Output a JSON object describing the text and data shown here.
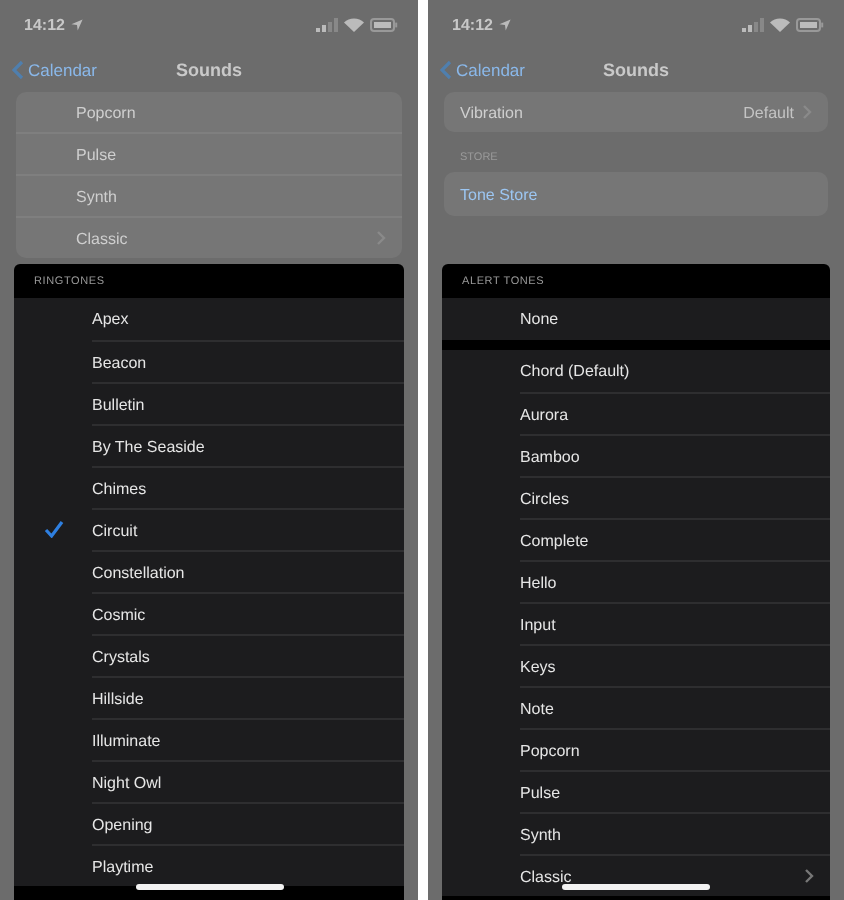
{
  "screens": [
    {
      "status": {
        "time": "14:12"
      },
      "nav": {
        "back": "Calendar",
        "title": "Sounds"
      },
      "top": [
        {
          "kind": "card",
          "rows": [
            {
              "label": "Popcorn",
              "chevron": false
            },
            {
              "label": "Pulse",
              "chevron": false
            },
            {
              "label": "Synth",
              "chevron": false
            },
            {
              "label": "Classic",
              "chevron": true
            }
          ]
        }
      ],
      "section": {
        "header": "RINGTONES",
        "groups": [
          [
            {
              "label": "Apex",
              "checked": false
            },
            {
              "label": "Beacon",
              "checked": false
            },
            {
              "label": "Bulletin",
              "checked": false
            },
            {
              "label": "By The Seaside",
              "checked": false
            },
            {
              "label": "Chimes",
              "checked": false
            },
            {
              "label": "Circuit",
              "checked": true
            },
            {
              "label": "Constellation",
              "checked": false
            },
            {
              "label": "Cosmic",
              "checked": false
            },
            {
              "label": "Crystals",
              "checked": false
            },
            {
              "label": "Hillside",
              "checked": false
            },
            {
              "label": "Illuminate",
              "checked": false
            },
            {
              "label": "Night Owl",
              "checked": false
            },
            {
              "label": "Opening",
              "checked": false
            },
            {
              "label": "Playtime",
              "checked": false
            }
          ]
        ]
      }
    },
    {
      "status": {
        "time": "14:12"
      },
      "nav": {
        "back": "Calendar",
        "title": "Sounds"
      },
      "top": [
        {
          "kind": "card",
          "rows": [
            {
              "label": "Vibration",
              "value": "Default",
              "chevron": true
            }
          ]
        },
        {
          "kind": "header",
          "text": "STORE"
        },
        {
          "kind": "link",
          "text": "Tone Store"
        }
      ],
      "section": {
        "header": "ALERT TONES",
        "groups": [
          [
            {
              "label": "None",
              "checked": false
            }
          ],
          [
            {
              "label": "Chord (Default)",
              "checked": false
            },
            {
              "label": "Aurora",
              "checked": false
            },
            {
              "label": "Bamboo",
              "checked": false
            },
            {
              "label": "Circles",
              "checked": false
            },
            {
              "label": "Complete",
              "checked": false
            },
            {
              "label": "Hello",
              "checked": false
            },
            {
              "label": "Input",
              "checked": false
            },
            {
              "label": "Keys",
              "checked": false
            },
            {
              "label": "Note",
              "checked": false
            },
            {
              "label": "Popcorn",
              "checked": false
            },
            {
              "label": "Pulse",
              "checked": false
            },
            {
              "label": "Synth",
              "checked": false
            },
            {
              "label": "Classic",
              "checked": false,
              "chevron": true
            }
          ]
        ]
      }
    }
  ]
}
